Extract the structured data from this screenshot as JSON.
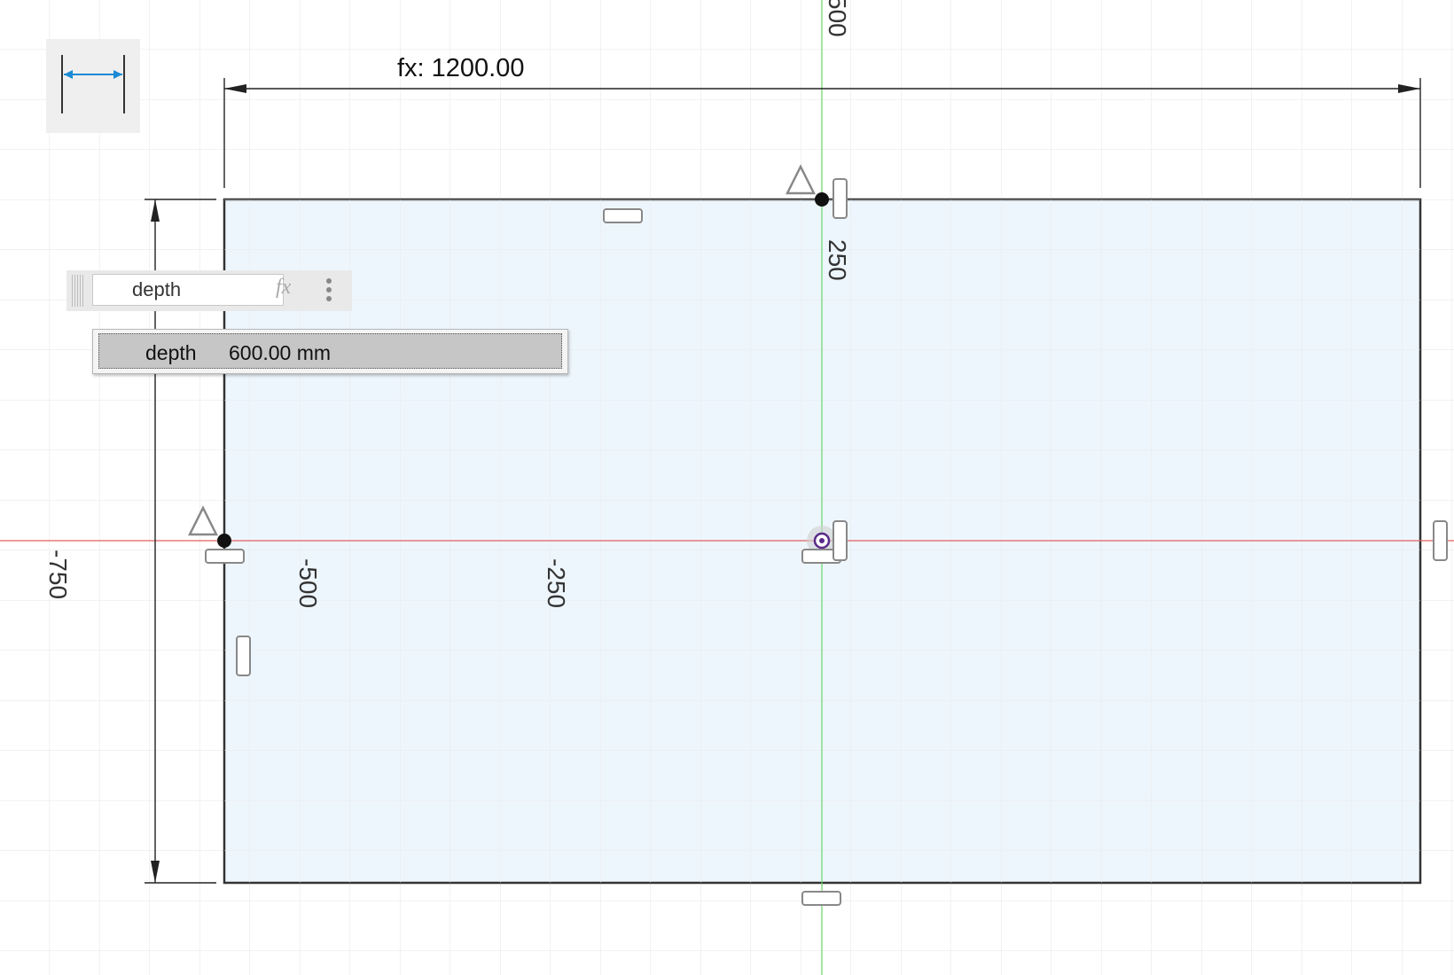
{
  "dimension_tool": {
    "icon": "horizontal-dimension-icon"
  },
  "dimensions": {
    "horizontal": "fx: 1200.00"
  },
  "dimension_input": {
    "value": "depth",
    "fx_label": "fx"
  },
  "autocomplete": {
    "name": "depth",
    "value": "600.00 mm"
  },
  "grid_labels": {
    "x_neg500": "-500",
    "x_neg250": "-250",
    "y_250": "250",
    "y_500": "500",
    "y_neg750": "-750"
  },
  "colors": {
    "profile_fill": "#eef6fd",
    "x_axis": "#e06060",
    "y_axis": "#6ad46a",
    "grid": "#dedede",
    "accent": "#1c8ad4"
  }
}
